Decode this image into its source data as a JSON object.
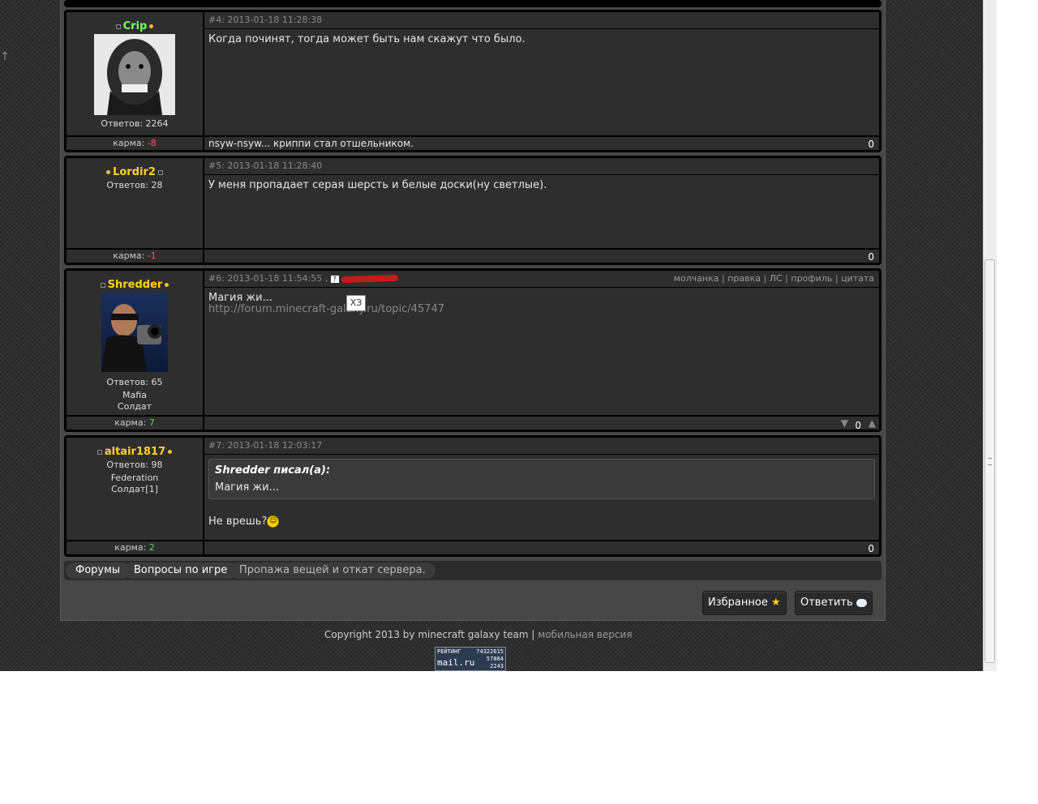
{
  "posts": [
    {
      "id": "#4",
      "timestamp": "2013-01-18 11:28:38",
      "author": "Crip",
      "replies_label": "Ответов: 2264",
      "text": "Когда починят, тогда может быть нам скажут что было.",
      "karma_label": "карма:",
      "karma": "-8",
      "signature": "nsyw-nsyw... криппи стал отшельником.",
      "score": "0"
    },
    {
      "id": "#5",
      "timestamp": "2013-01-18 11:28:40",
      "author": "Lordir2",
      "replies_label": "Ответов: 28",
      "text": "У меня пропадает серая шерсть и белые доски(ну светлые).",
      "karma_label": "карма:",
      "karma": "-1",
      "score": "0"
    },
    {
      "id": "#6",
      "timestamp": "2013-01-18 11:54:55",
      "author": "Shredder",
      "replies_label": "Ответов: 65",
      "clan": "Mafia",
      "rank": "Солдат",
      "text": "Магия жи...",
      "link": "http://forum.minecraft-galaxy.ru/topic/45747",
      "tooltip": "ХЗ",
      "karma_label": "карма:",
      "karma": "7",
      "score": "0",
      "actions": [
        "молчанка",
        "правка",
        "ЛС",
        "профиль",
        "цитата"
      ]
    },
    {
      "id": "#7",
      "timestamp": "2013-01-18 12:03:17",
      "author": "altair1817",
      "replies_label": "Ответов: 98",
      "clan": "Federation",
      "rank": "Солдат[1]",
      "quote_title": "Shredder писал(а):",
      "quote_text": "Магия жи...",
      "text": "Не врешь?",
      "karma_label": "карма:",
      "karma": "2",
      "score": "0"
    }
  ],
  "breadcrumb": [
    "Форумы",
    "Вопросы по игре",
    "Пропажа вещей и откат сервера."
  ],
  "buttons": {
    "favorites": "Избранное",
    "reply": "Ответить"
  },
  "footer": {
    "copyright": "Copyright 2013 by minecraft galaxy team",
    "separator": "|",
    "mobile": "мобильная версия"
  },
  "counter": {
    "label": "РЕЙТИНГ",
    "brand": "mail.ru",
    "v1": "74322615",
    "v2": "57884",
    "v3": "2243"
  },
  "colors": {
    "name_green": "#7cfc5a",
    "name_yellow": "#ffd21f",
    "karma_neg": "#ff5a5a",
    "karma_pos": "#5fd35f"
  }
}
